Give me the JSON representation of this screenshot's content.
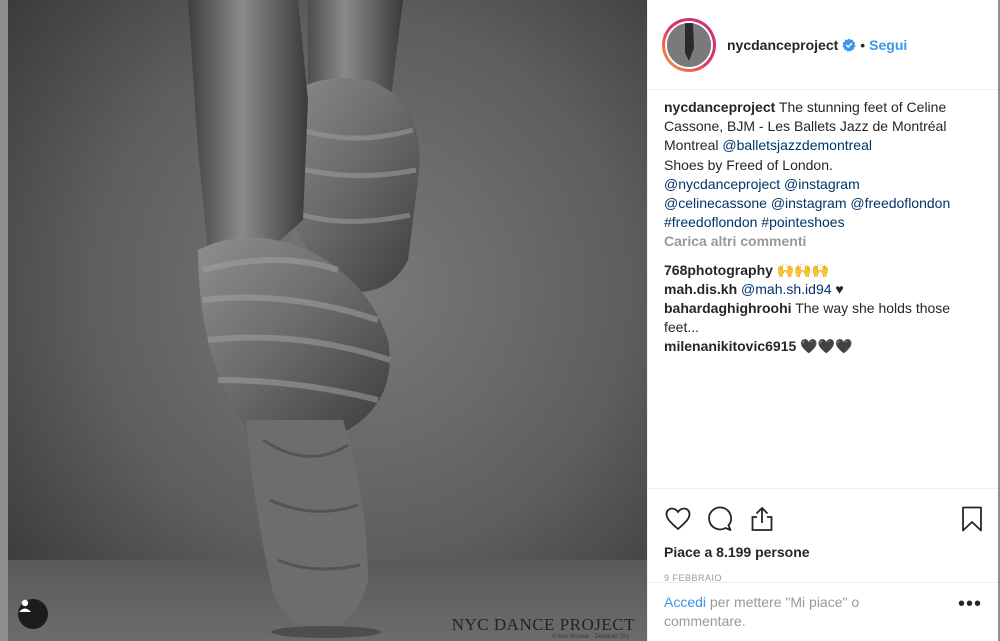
{
  "post": {
    "username": "nycdanceproject",
    "follow_label": "Segui",
    "dot": "•",
    "caption_user": "nycdanceproject",
    "caption_text": " The stunning feet of Celine Cassone, BJM - Les Ballets Jazz de Montréal Montreal ",
    "caption_mention": "@balletsjazzdemontreal",
    "caption_line2": "Shoes by Freed of London.",
    "tags_line1": "@nycdanceproject @instagram",
    "tags_line2": "@celinecassone @instagram @freedoflondon",
    "tags_line3": "#freedoflondon #pointeshoes",
    "load_more": "Carica altri commenti",
    "watermark": "NYC DANCE PROJECT",
    "watermark_sub": "© Ken Browar · Deborah Ory",
    "likes": "Piace a 8.199 persone",
    "date": "9 FEBBRAIO",
    "login_link": "Accedi",
    "login_rest": " per mettere \"Mi piace\" o commentare.",
    "more_label": "•••"
  },
  "comments": [
    {
      "user": "768photography",
      "text": " 🙌🙌🙌",
      "mention": ""
    },
    {
      "user": "mah.dis.kh",
      "text": " ♥",
      "mention": " @mah.sh.id94"
    },
    {
      "user": "bahardaghighroohi",
      "text": " The way she holds those feet...",
      "mention": ""
    },
    {
      "user": "milenanikitovic6915",
      "text": " 🖤🖤🖤",
      "mention": ""
    }
  ],
  "icons": {
    "like": "heart-icon",
    "comment": "comment-icon",
    "share": "share-icon",
    "save": "bookmark-icon",
    "verified": "verified-badge-icon",
    "user": "user-icon"
  },
  "colors": {
    "link": "#3897f0",
    "mention": "#003569",
    "muted": "#999999"
  }
}
